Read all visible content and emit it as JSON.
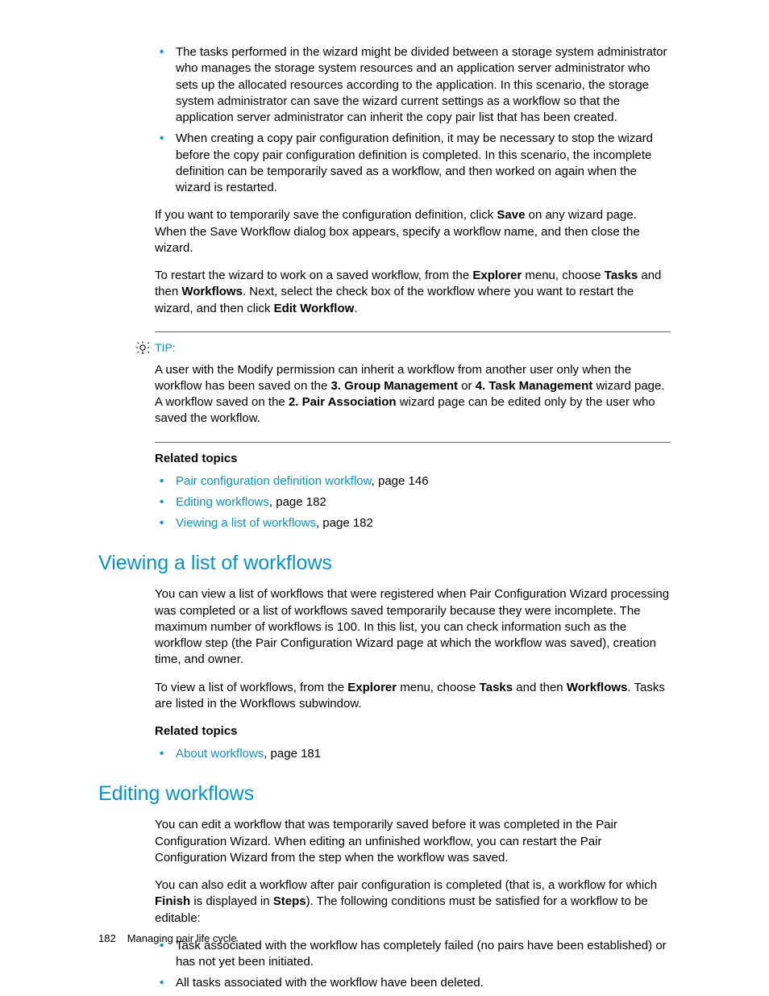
{
  "intro": {
    "bullets": [
      "The tasks performed in the wizard might be divided between a storage system administrator who manages the storage system resources and an application server administrator who sets up the allocated resources according to the application. In this scenario, the storage system administrator can save the wizard current settings as a workflow so that the application server administrator can inherit the copy pair list that has been created.",
      "When creating a copy pair configuration definition, it may be necessary to stop the wizard before the copy pair configuration definition is completed. In this scenario, the incomplete definition can be temporarily saved as a workflow, and then worked on again when the wizard is restarted."
    ],
    "p1_a": "If you want to temporarily save the configuration definition, click ",
    "p1_save": "Save",
    "p1_b": " on any wizard page. When the Save Workflow dialog box appears, specify a workflow name, and then close the wizard.",
    "p2_a": "To restart the wizard to work on a saved workflow, from the ",
    "p2_explorer": "Explorer",
    "p2_b": " menu, choose ",
    "p2_tasks": "Tasks",
    "p2_c": " and then ",
    "p2_workflows": "Workflows",
    "p2_d": ". Next, select the check box of the workflow where you want to restart the wizard, and then click ",
    "p2_edit": "Edit Workflow",
    "p2_e": "."
  },
  "tip": {
    "label": "TIP:",
    "a": "A user with the Modify permission can inherit a workflow from another user only when the workflow has been saved on the ",
    "s3": "3. Group Management",
    "b": " or ",
    "s4": "4. Task Management",
    "c": " wizard page. A workflow saved on the ",
    "s2": "2. Pair Association",
    "d": " wizard page can be edited only by the user who saved the workflow."
  },
  "related1": {
    "heading": "Related topics",
    "items": [
      {
        "link": "Pair configuration definition workflow",
        "rest": ", page 146"
      },
      {
        "link": "Editing workflows",
        "rest": ", page 182"
      },
      {
        "link": "Viewing a list of workflows",
        "rest": ", page 182"
      }
    ]
  },
  "sec_view": {
    "title": "Viewing a list of workflows",
    "p1": "You can view a list of workflows that were registered when Pair Configuration Wizard processing was completed or a list of workflows saved temporarily because they were incomplete. The maximum number of workflows is 100. In this list, you can check information such as the workflow step (the Pair Configuration Wizard page at which the workflow was saved), creation time, and owner.",
    "p2_a": "To view a list of workflows, from the ",
    "p2_explorer": "Explorer",
    "p2_b": " menu, choose ",
    "p2_tasks": "Tasks",
    "p2_c": " and then ",
    "p2_workflows": "Workflows",
    "p2_d": ". Tasks are listed in the Workflows subwindow.",
    "related_heading": "Related topics",
    "related": [
      {
        "link": "About workflows",
        "rest": ", page 181"
      }
    ]
  },
  "sec_edit": {
    "title": "Editing workflows",
    "p1": "You can edit a workflow that was temporarily saved before it was completed in the Pair Configuration Wizard. When editing an unfinished workflow,  you can restart the Pair Configuration Wizard from the step when the workflow was saved.",
    "p2_a": "You can also edit a workflow after pair configuration is completed (that is, a workflow for which ",
    "p2_finish": "Finish",
    "p2_b": " is displayed in ",
    "p2_steps": "Steps",
    "p2_c": ").  The following conditions must be satisfied for a workflow to be editable:",
    "bullets": [
      "Task associated with the workflow has completely failed (no pairs have been established) or has not yet been initiated.",
      "All tasks associated with the workflow have been deleted."
    ]
  },
  "footer": {
    "page": "182",
    "title": "Managing pair life cycle"
  }
}
